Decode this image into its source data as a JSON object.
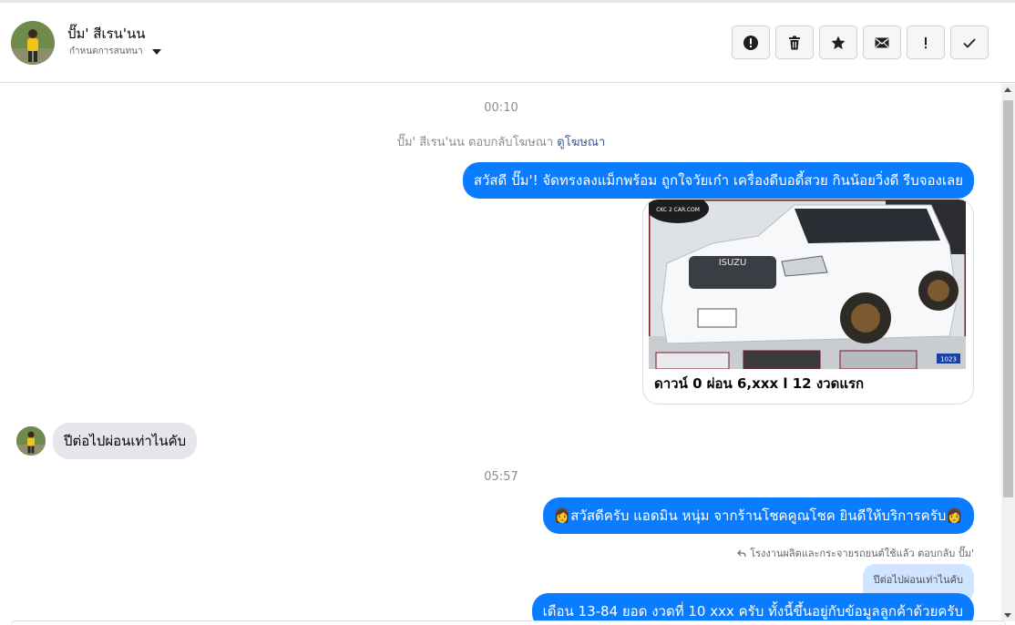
{
  "header": {
    "contact_name": "ปั๊ม' สีเรน'นน",
    "status_label": "กำหนดการสนทนา",
    "actions": [
      {
        "name": "report-button",
        "icon": "alert-circle-icon"
      },
      {
        "name": "delete-button",
        "icon": "trash-icon"
      },
      {
        "name": "star-button",
        "icon": "star-icon"
      },
      {
        "name": "mark-unread-button",
        "icon": "envelope-icon"
      },
      {
        "name": "follow-up-button",
        "icon": "exclamation-icon"
      },
      {
        "name": "mark-done-button",
        "icon": "check-icon"
      }
    ]
  },
  "thread": {
    "time_1": "00:10",
    "ad_notice_text": "ปั๊ม' สีเรน'นน ตอบกลับโฆษณา",
    "ad_notice_link": "ดูโฆษณา",
    "msg_out_1": "สวัสดี ปั๊ม'! จัดทรงลงแม็กพร้อม ถูกใจวัยเก๋า เครื่องดีบอดี้สวย กินน้อยวิ่งดี รีบจองเลย",
    "card_logo_text": "CKC 2 CAR.COM",
    "card_brand_text": "ISUZU",
    "card_corner_code": "1023",
    "card_caption": "ดาวน์ 0 ผ่อน 6,xxx l 12 งวดแรก",
    "msg_in_1": "ปีต่อไปผ่อนเท่าไนคับ",
    "time_2": "05:57",
    "msg_out_2_emoji": "👩",
    "msg_out_2": "สวัสดีครับ แอดมิน หนุ่ม จากร้านโชคคูณโชค ยินดีให้บริการครับ",
    "reply_note": "โรงงานผลิตและกระจายรถยนต์ใช้แล้ว ตอบกลับ ปั๊ม'",
    "quoted_text": "ปีต่อไปผ่อนเท่าไนคับ",
    "msg_out_3_partial": "เดือน 13-84 ยอด งวดที่ 10 xxx ครับ ทั้งนี้ขึ้นอยู่กับข้อมูลลูกค้าด้วยครับ"
  },
  "colors": {
    "outgoing_bubble": "#0a7cff",
    "incoming_bubble": "#e4e6eb",
    "quoted_bubble": "#cfe4ff",
    "link": "#385898"
  }
}
